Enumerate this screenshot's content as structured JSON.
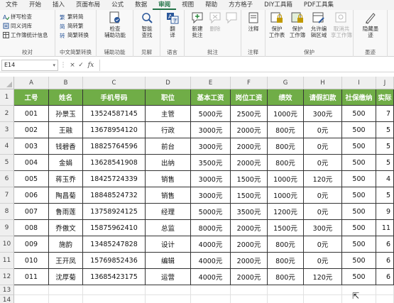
{
  "menu": [
    "文件",
    "开始",
    "插入",
    "页面布局",
    "公式",
    "数据",
    "审阅",
    "视图",
    "帮助",
    "方方格子",
    "DIY工具箱",
    "PDF工具集"
  ],
  "menu_active_index": 6,
  "ribbon": {
    "proofing": {
      "items": [
        "拼写检查",
        "同义词库",
        "工作簿统计信息"
      ],
      "label": "校对"
    },
    "chinese": {
      "items": [
        "繁转简",
        "简转繁",
        "简繁转换"
      ],
      "label": "中文简繁转换"
    },
    "accessibility": {
      "button": [
        "检查",
        "辅助功能"
      ],
      "label": "辅助功能"
    },
    "insights": {
      "button": [
        "智能",
        "查找"
      ],
      "label": "见解"
    },
    "language": {
      "button": [
        "翻",
        "译"
      ],
      "label": "语言"
    },
    "comments": {
      "buttons": [
        [
          "新建",
          "批注"
        ],
        [
          "删除",
          ""
        ],
        [
          "",
          ""
        ]
      ],
      "label": "批注"
    },
    "notes": {
      "button": [
        "注释",
        ""
      ],
      "label": "注释"
    },
    "protect": {
      "buttons": [
        [
          "保护",
          "工作表"
        ],
        [
          "保护",
          "工作簿"
        ],
        [
          "允许编",
          "辑区域"
        ],
        [
          "取消共",
          "享工作簿"
        ]
      ],
      "label": "保护"
    },
    "ink": {
      "button": [
        "隐藏墨",
        "迹"
      ],
      "label": "墨迹"
    }
  },
  "formula_bar": {
    "name_box": "E14",
    "formula": ""
  },
  "columns": [
    "A",
    "B",
    "C",
    "D",
    "E",
    "F",
    "G",
    "H",
    "I",
    "J"
  ],
  "row_numbers": [
    "1",
    "2",
    "3",
    "4",
    "5",
    "6",
    "7",
    "8",
    "9",
    "10",
    "11",
    "12",
    "13",
    "14"
  ],
  "table": {
    "headers": [
      "工号",
      "姓名",
      "手机号码",
      "职位",
      "基本工资",
      "岗位工资",
      "绩效",
      "请假扣款",
      "社保缴纳",
      "实际"
    ],
    "rows": [
      [
        "001",
        "孙景玉",
        "13524587145",
        "主管",
        "5000元",
        "2500元",
        "1000元",
        "300元",
        "500",
        "7"
      ],
      [
        "002",
        "王融",
        "13678954120",
        "行政",
        "3000元",
        "2000元",
        "800元",
        "0元",
        "500",
        "5"
      ],
      [
        "003",
        "钱碧香",
        "18825764596",
        "前台",
        "3000元",
        "2000元",
        "800元",
        "0元",
        "500",
        "5"
      ],
      [
        "004",
        "金娟",
        "13628541908",
        "出纳",
        "3500元",
        "2000元",
        "800元",
        "0元",
        "500",
        "5"
      ],
      [
        "005",
        "蒋玉乔",
        "18425724339",
        "销售",
        "3000元",
        "1500元",
        "1000元",
        "120元",
        "500",
        "4"
      ],
      [
        "006",
        "陶昌菊",
        "18848524732",
        "销售",
        "3000元",
        "1500元",
        "1000元",
        "0元",
        "500",
        "5"
      ],
      [
        "007",
        "鲁雨莲",
        "13758924125",
        "经理",
        "5000元",
        "3500元",
        "1200元",
        "0元",
        "500",
        "9"
      ],
      [
        "008",
        "乔傲文",
        "15875962410",
        "总监",
        "8000元",
        "2000元",
        "1500元",
        "300元",
        "500",
        "11"
      ],
      [
        "009",
        "施韵",
        "13485247828",
        "设计",
        "4000元",
        "2000元",
        "800元",
        "0元",
        "500",
        "6"
      ],
      [
        "010",
        "王开凤",
        "15769852436",
        "编辑",
        "4000元",
        "2000元",
        "800元",
        "0元",
        "500",
        "6"
      ],
      [
        "011",
        "沈厚菊",
        "13685423175",
        "运营",
        "4000元",
        "2000元",
        "800元",
        "120元",
        "500",
        "6"
      ]
    ]
  },
  "colors": {
    "header_fill": "#70ad47",
    "accent": "#217346"
  }
}
